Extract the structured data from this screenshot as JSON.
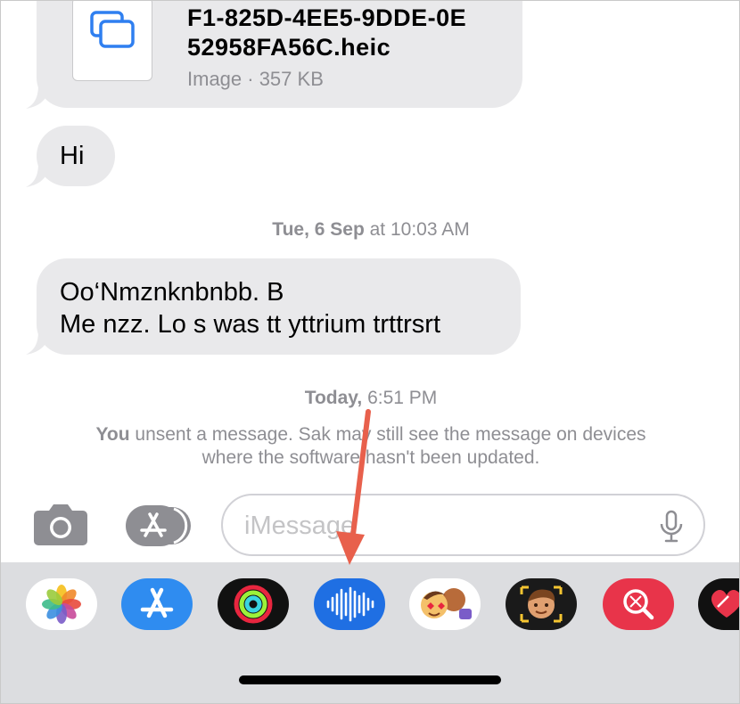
{
  "messages": {
    "file": {
      "name_line1": "F1-825D-4EE5-9DDE-0E",
      "name_line2": "52958FA56C.heic",
      "meta": "Image · 357 KB",
      "icon": "image-stack-icon"
    },
    "hi": {
      "text": "Hi"
    },
    "timestamp1": {
      "day": "Tue, 6 Sep",
      "time": " at 10:03 AM"
    },
    "long": {
      "line1": "Oo‘Nmznknbnbb.   B",
      "line2": "Me nzz. Lo s was tt yttrium trttrsrt"
    },
    "timestamp2": {
      "day": "Today,",
      "time": " 6:51 PM"
    },
    "unsent": {
      "you": "You",
      "line1_rest": " unsent a message. Sak may still see the message on devices",
      "line2": "where the software hasn't been updated."
    }
  },
  "compose": {
    "placeholder": "iMessage",
    "camera_icon": "camera-icon",
    "apps_icon": "app-store-icon",
    "mic_icon": "microphone-icon"
  },
  "drawer": {
    "apps": [
      "photos-app-icon",
      "app-store-app-icon",
      "fitness-app-icon",
      "audio-message-app-icon",
      "memoji-stickers-app-icon",
      "memoji-app-icon",
      "images-search-app-icon",
      "digital-touch-app-icon"
    ]
  },
  "colors": {
    "bubble": "#e9e9eb",
    "secondary_text": "#8e8e93",
    "drawer_bg": "#dcdde0",
    "accent_blue": "#1a73e8",
    "arrow": "#e8604c"
  }
}
